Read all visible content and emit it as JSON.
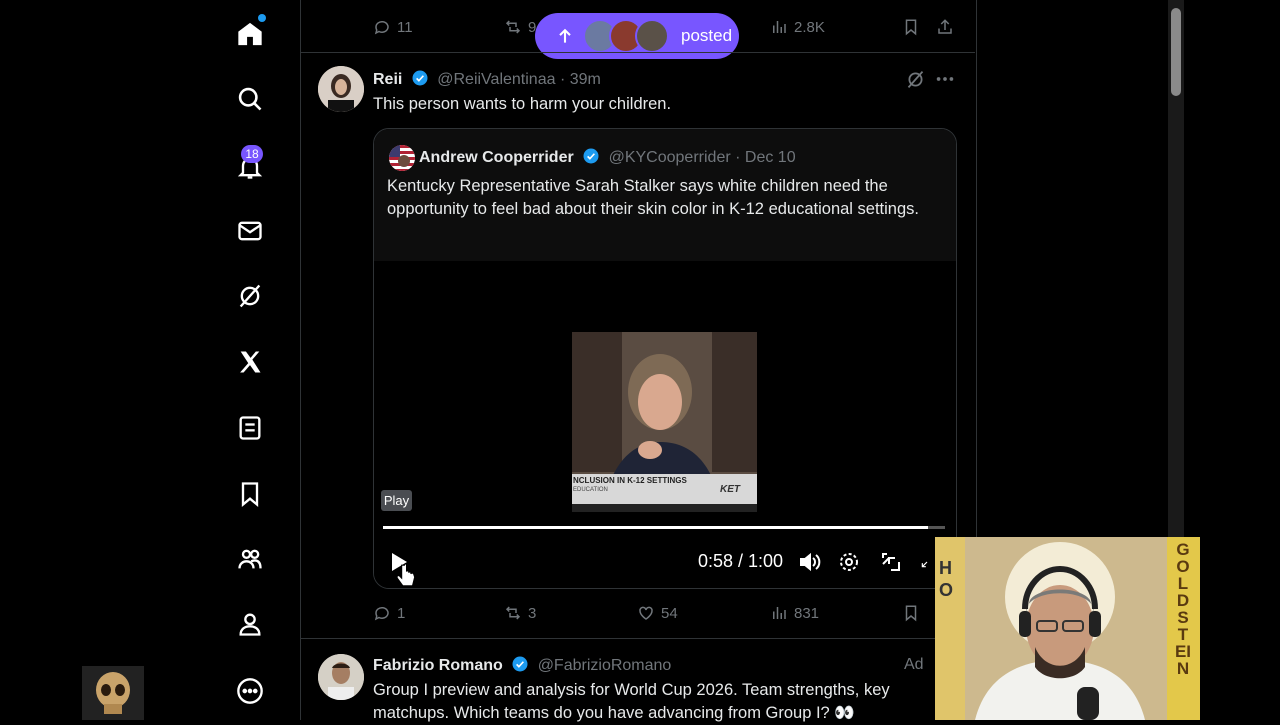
{
  "nav": {
    "notifications_badge": "18",
    "items": [
      "home-icon",
      "search-icon",
      "notifications-icon",
      "messages-icon",
      "grok-icon",
      "x-premium-icon",
      "lists-icon",
      "bookmarks-icon",
      "communities-icon",
      "profile-icon",
      "more-icon"
    ]
  },
  "posted_pill": {
    "label": "posted"
  },
  "prev_tweet": {
    "replies": "11",
    "retweets": "9",
    "views": "2.8K"
  },
  "tweet": {
    "name": "Reii",
    "handle": "@ReiiValentinaa",
    "time": "· 39m",
    "text": "This person wants to harm your children.",
    "replies": "1",
    "retweets": "3",
    "likes": "54",
    "views": "831"
  },
  "quote": {
    "name": "Andrew Cooperrider",
    "handle": "@KYCooperrider",
    "time": "· Dec 10",
    "text": "Kentucky Representative Sarah Stalker says white children need the opportunity to feel bad about their skin color in K-12 educational settings."
  },
  "video": {
    "lower_third": "NCLUSION IN K-12 SETTINGS",
    "lower_third_sub": "EDUCATION",
    "station": "KET",
    "play_tooltip": "Play",
    "time_display": "0:58 / 1:00",
    "progress": 0.97
  },
  "next_tweet": {
    "name": "Fabrizio Romano",
    "handle": "@FabrizioRomano",
    "ad_label": "Ad",
    "text": "Group I preview and analysis for World Cup 2026. Team strengths, key matchups. Which teams do you have advancing from Group I? 👀"
  },
  "webcam": {
    "side_text": "GOLDSTEIN"
  },
  "colors": {
    "accent": "#1d9bf0",
    "pill": "#7856ff",
    "badge": "#7856ff"
  }
}
